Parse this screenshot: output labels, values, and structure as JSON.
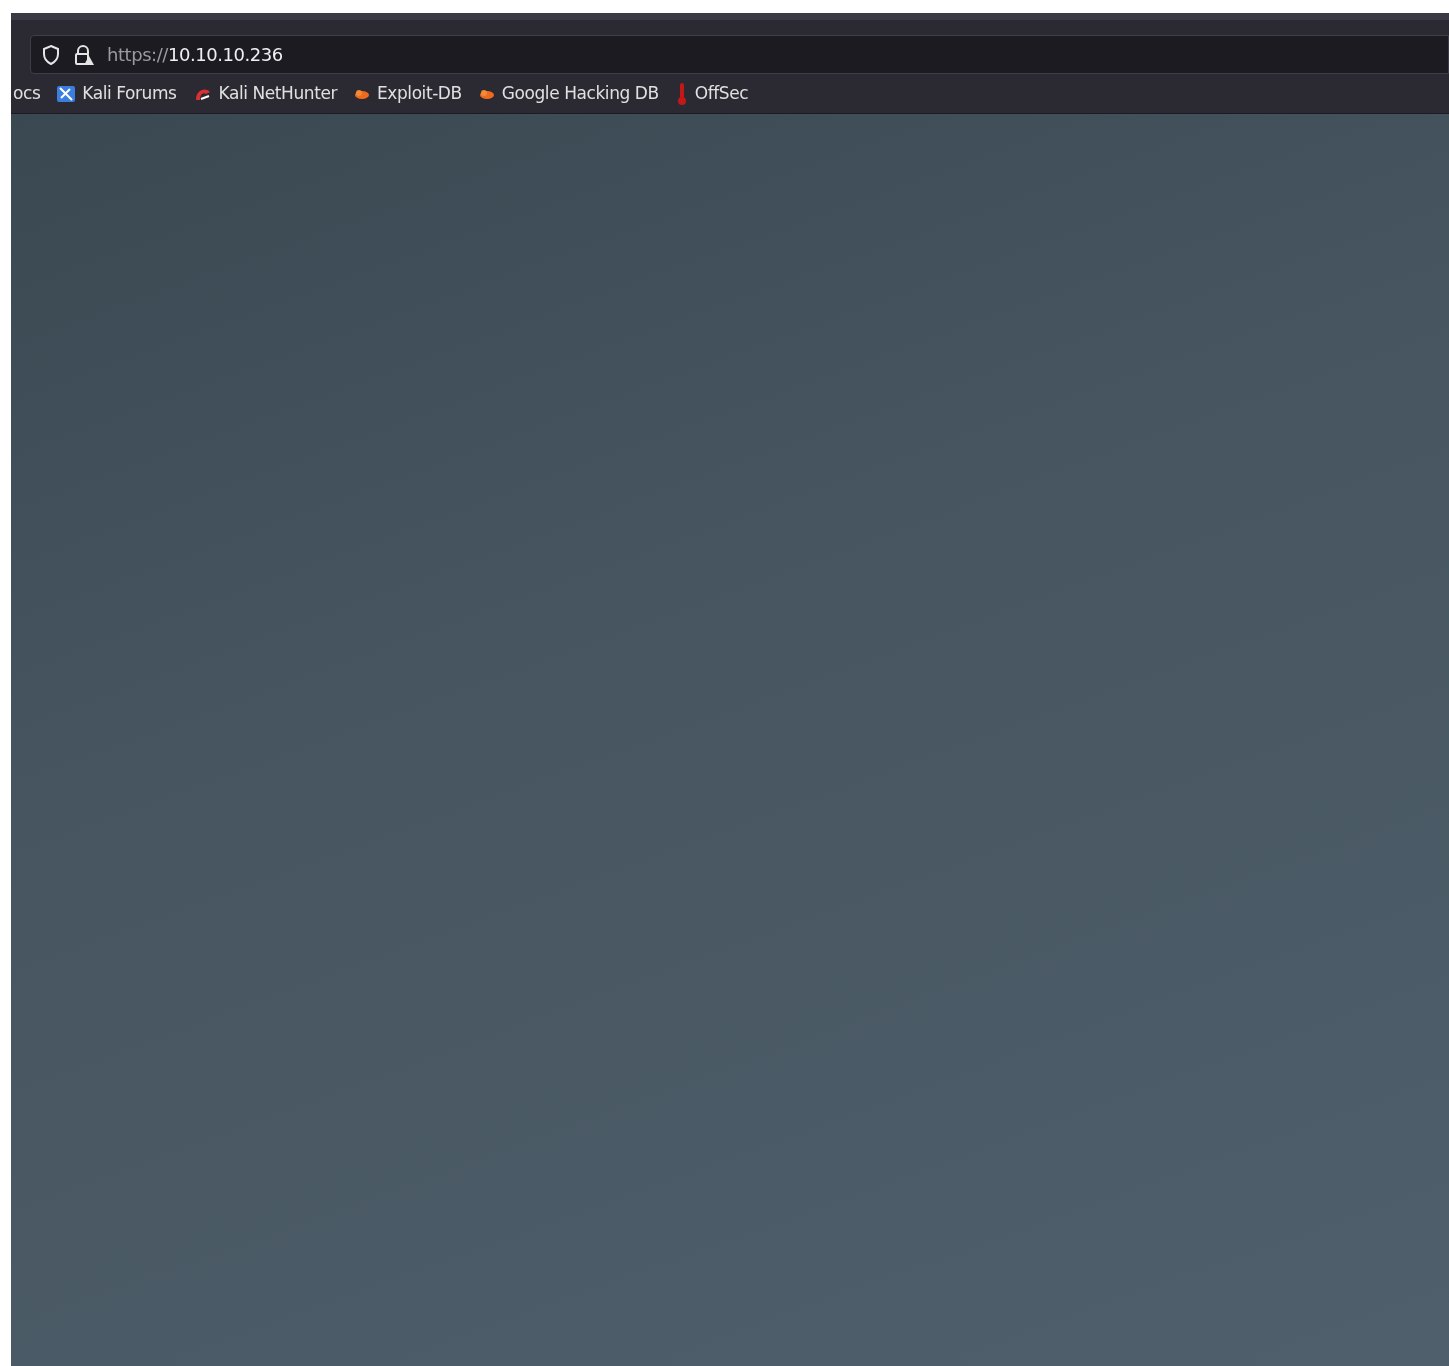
{
  "address_bar": {
    "scheme": "https://",
    "host": "10.10.10.236"
  },
  "bookmarks": [
    {
      "label": "ocs",
      "kind": "none"
    },
    {
      "label": "Kali Forums",
      "kind": "forums"
    },
    {
      "label": "Kali NetHunter",
      "kind": "nethunter"
    },
    {
      "label": "Exploit-DB",
      "kind": "exploit"
    },
    {
      "label": "Google Hacking DB",
      "kind": "exploit"
    },
    {
      "label": "OffSec",
      "kind": "offsec"
    }
  ]
}
